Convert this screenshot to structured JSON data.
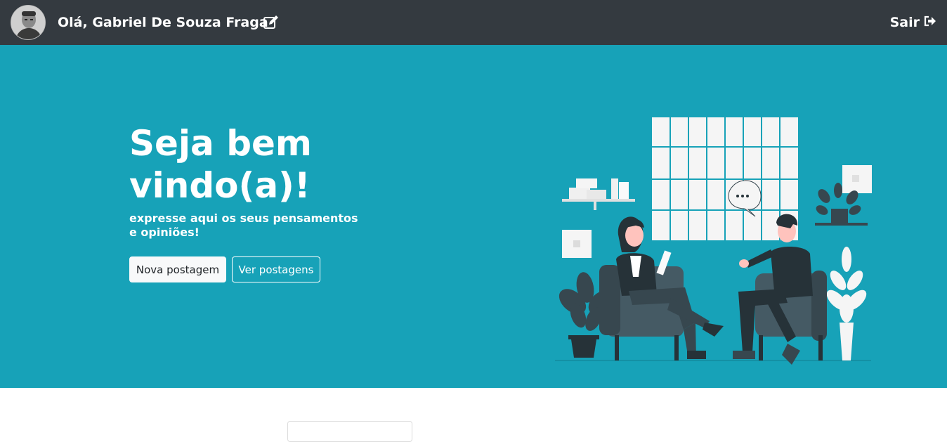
{
  "header": {
    "greeting": "Olá, Gabriel De Souza Fraga",
    "logout_label": "Sair"
  },
  "hero": {
    "title": "Seja bem vindo(a)!",
    "subtitle": "expresse aqui os seus pensamentos e opiniões!",
    "new_post_label": "Nova postagem",
    "view_posts_label": "Ver postagens"
  },
  "colors": {
    "navbar": "#343a40",
    "hero": "#17a2b8",
    "text": "#ffffff"
  },
  "icons": [
    "user-avatar",
    "edit-icon",
    "logout-icon"
  ]
}
